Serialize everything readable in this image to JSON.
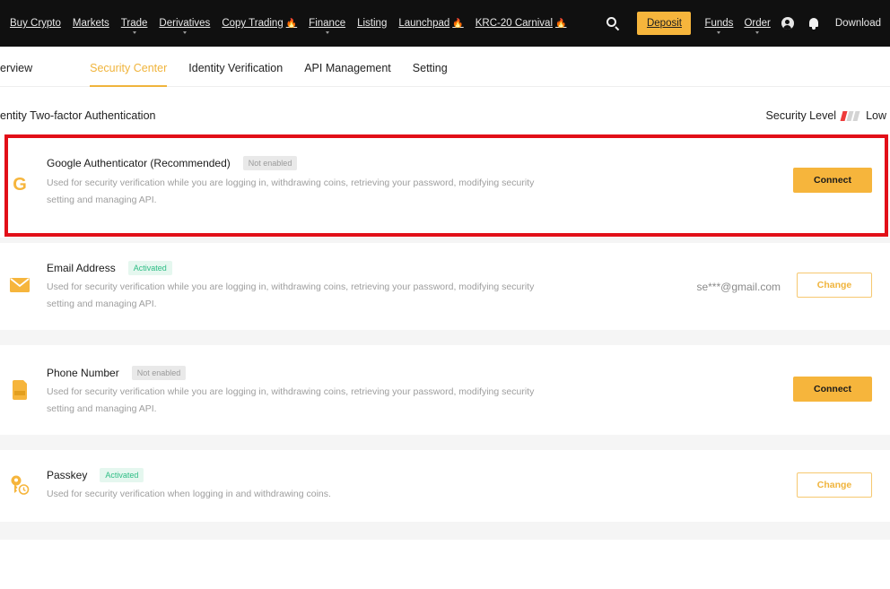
{
  "nav": {
    "items": [
      {
        "label": "Buy Crypto",
        "flame": false,
        "caret": false
      },
      {
        "label": "Markets",
        "flame": false,
        "caret": false
      },
      {
        "label": "Trade",
        "flame": false,
        "caret": true
      },
      {
        "label": "Derivatives",
        "flame": false,
        "caret": true
      },
      {
        "label": "Copy Trading",
        "flame": true,
        "caret": false
      },
      {
        "label": "Finance",
        "flame": false,
        "caret": true
      },
      {
        "label": "Listing",
        "flame": false,
        "caret": false
      },
      {
        "label": "Launchpad",
        "flame": true,
        "caret": false
      },
      {
        "label": "KRC-20 Carnival",
        "flame": true,
        "caret": false
      }
    ],
    "flame_glyph": "🔥",
    "deposit_label": "Deposit",
    "funds_label": "Funds",
    "order_label": "Order",
    "download_label": "Download"
  },
  "subtabs": [
    {
      "label": "erview",
      "active": false
    },
    {
      "label": "Security Center",
      "active": true
    },
    {
      "label": "Identity Verification",
      "active": false
    },
    {
      "label": "API Management",
      "active": false
    },
    {
      "label": "Setting",
      "active": false
    }
  ],
  "section": {
    "title": "entity Two-factor Authentication",
    "security_level_label": "Security Level",
    "security_level_value": "Low",
    "security_level_bars_on": 1,
    "security_level_bars_total": 3
  },
  "methods": [
    {
      "title": "Google Authenticator  (Recommended)",
      "status": "Not enabled",
      "status_on": false,
      "description": "Used for security verification while you are logging in, withdrawing coins, retrieving your password, modifying security setting and managing API.",
      "action": "Connect",
      "icon": "google-authenticator-icon"
    },
    {
      "title": "Email Address",
      "status": "Activated",
      "status_on": true,
      "description": "Used for security verification while you are logging in, withdrawing coins, retrieving your password, modifying security setting and managing API.",
      "value": "se***@gmail.com",
      "action": "Change",
      "icon": "email-icon"
    },
    {
      "title": "Phone Number",
      "status": "Not enabled",
      "status_on": false,
      "description": "Used for security verification while you are logging in, withdrawing coins, retrieving your password, modifying security setting and managing API.",
      "action": "Connect",
      "icon": "phone-sim-icon"
    },
    {
      "title": "Passkey",
      "status": "Activated",
      "status_on": true,
      "description": "Used for security verification when logging in and withdrawing coins.",
      "action": "Change",
      "icon": "passkey-icon"
    }
  ],
  "colors": {
    "accent": "#f6b53c",
    "highlight": "#e20f18",
    "activated": "#2ebd85",
    "level_low": "#ee3b3b"
  }
}
